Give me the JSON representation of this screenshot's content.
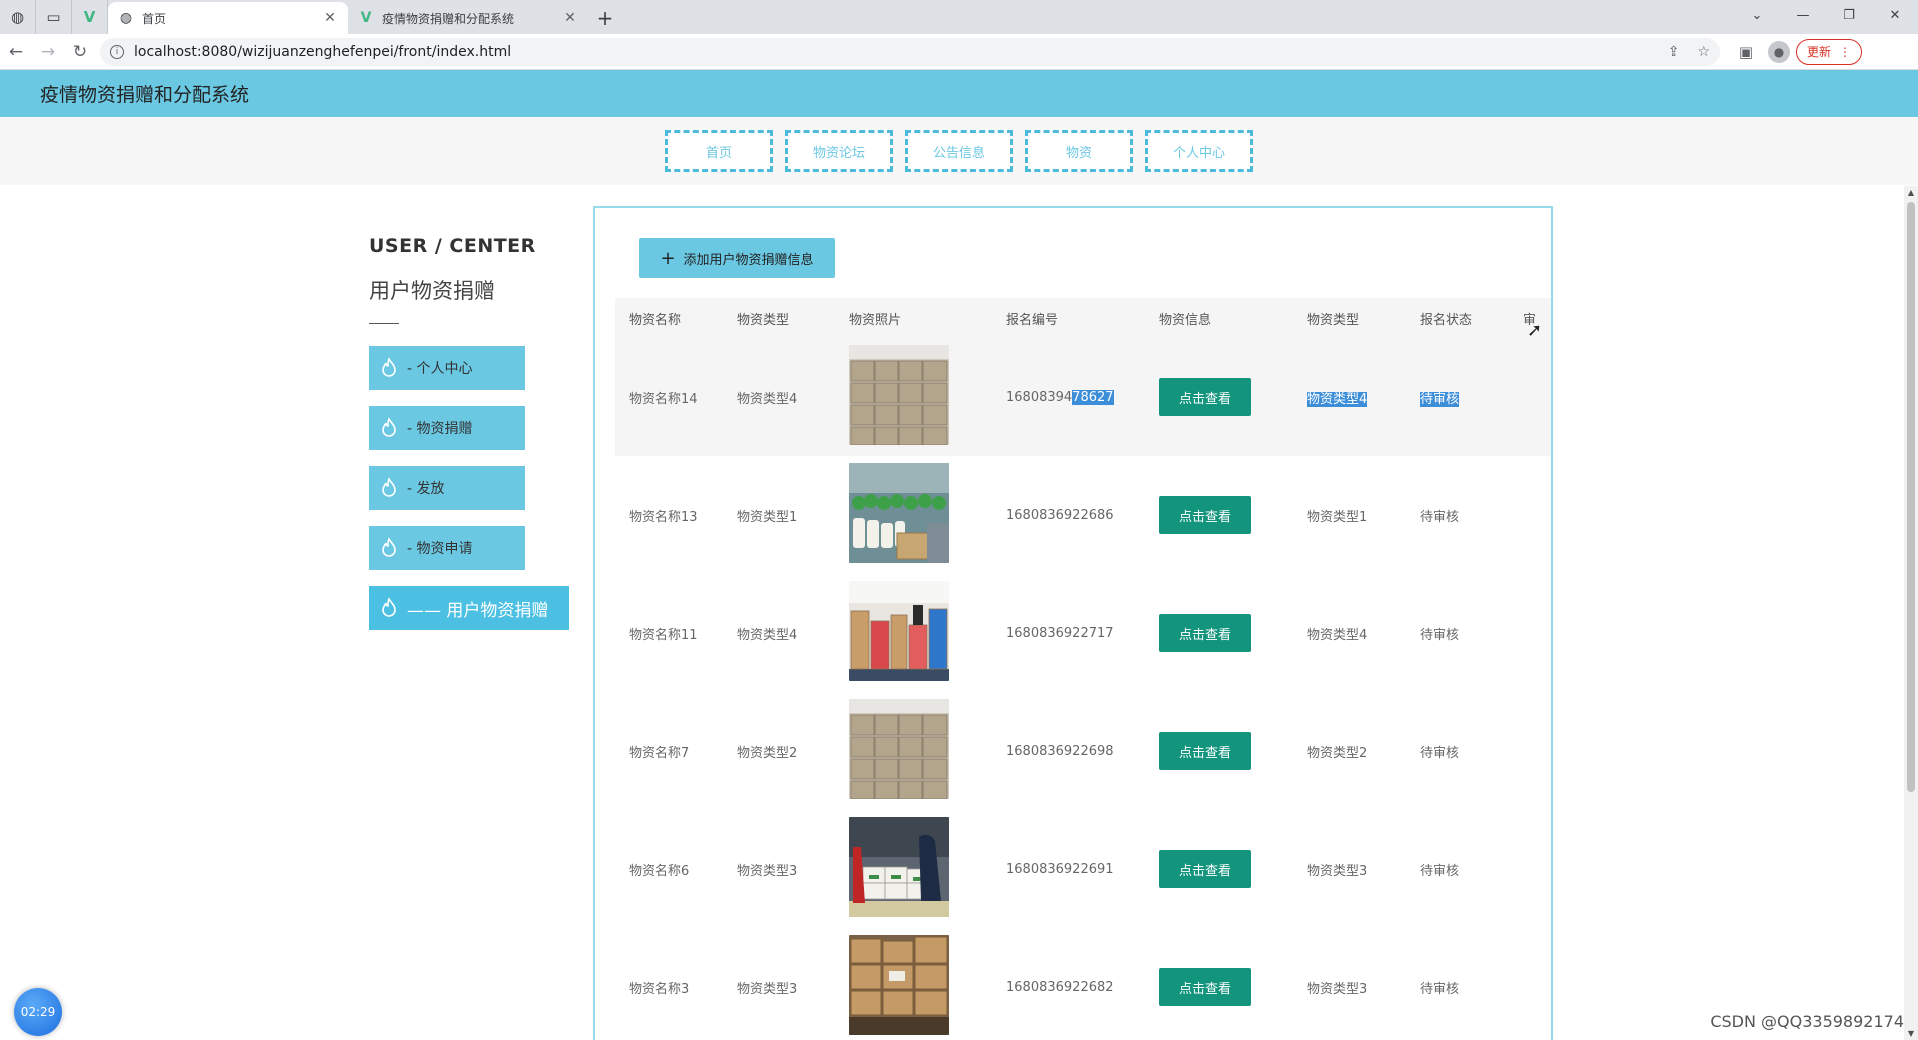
{
  "browser": {
    "tabs": [
      {
        "title": "首页",
        "active": true
      },
      {
        "title": "疫情物资捐赠和分配系统",
        "active": false
      }
    ],
    "url": "localhost:8080/wizijuanzenghefenpei/front/index.html",
    "update_label": "更新"
  },
  "site": {
    "title": "疫情物资捐赠和分配系统",
    "menu": [
      "首页",
      "物资论坛",
      "公告信息",
      "物资",
      "个人中心"
    ]
  },
  "sidebar": {
    "heading": "USER / CENTER",
    "subheading": "用户物资捐赠",
    "items": [
      {
        "label": "- 个人中心"
      },
      {
        "label": "- 物资捐赠"
      },
      {
        "label": "- 发放"
      },
      {
        "label": "- 物资申请"
      },
      {
        "label": "—— 用户物资捐赠"
      }
    ]
  },
  "main": {
    "add_button": "添加用户物资捐赠信息",
    "columns": [
      "物资名称",
      "物资类型",
      "物资照片",
      "报名编号",
      "物资信息",
      "物资类型",
      "报名状态",
      "审"
    ],
    "view_label": "点击查看",
    "rows": [
      {
        "name": "物资名称14",
        "type": "物资类型4",
        "photo": "stacked-boxes",
        "code_a": "16808394",
        "code_b": "78627",
        "type2": "物资类型4",
        "status": "待审核"
      },
      {
        "name": "物资名称13",
        "type": "物资类型1",
        "photo": "bottles-warehouse",
        "code": "1680836922686",
        "type2": "物资类型1",
        "status": "待审核"
      },
      {
        "name": "物资名称11",
        "type": "物资类型4",
        "photo": "supply-room",
        "code": "1680836922717",
        "type2": "物资类型4",
        "status": "待审核"
      },
      {
        "name": "物资名称7",
        "type": "物资类型2",
        "photo": "stacked-boxes",
        "code": "1680836922698",
        "type2": "物资类型2",
        "status": "待审核"
      },
      {
        "name": "物资名称6",
        "type": "物资类型3",
        "photo": "workers-loading",
        "code": "1680836922691",
        "type2": "物资类型3",
        "status": "待审核"
      },
      {
        "name": "物资名称3",
        "type": "物资类型3",
        "photo": "cardboard-boxes",
        "code": "1680836922682",
        "type2": "物资类型3",
        "status": "待审核"
      }
    ]
  },
  "overlay": {
    "timer": "02:29",
    "watermark": "CSDN @QQ3359892174"
  }
}
